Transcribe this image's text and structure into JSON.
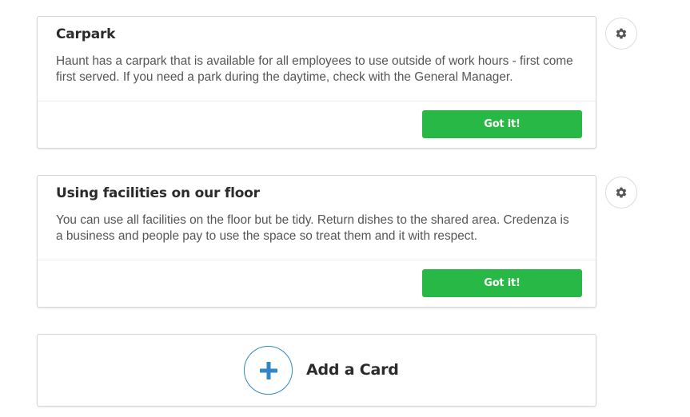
{
  "cards": [
    {
      "title": "Carpark",
      "text": "Haunt has a carpark that is available for all employees to use outside of work hours - first come first served. If you need a park during the daytime, check with the General Manager.",
      "button_label": "Got it!",
      "settings_icon": "gear-icon"
    },
    {
      "title": "Using facilities on our floor",
      "text": "You can use all facilities on the floor but be tidy. Return dishes to the shared area. Credenza is a business and people pay to use the space so treat them and it with respect.",
      "button_label": "Got it!",
      "settings_icon": "gear-icon"
    }
  ],
  "add_card": {
    "label": "Add a Card",
    "icon": "plus-icon"
  },
  "colors": {
    "button_green": "#27b845",
    "plus_blue": "#2f87c7",
    "gear_gray": "#555555"
  }
}
